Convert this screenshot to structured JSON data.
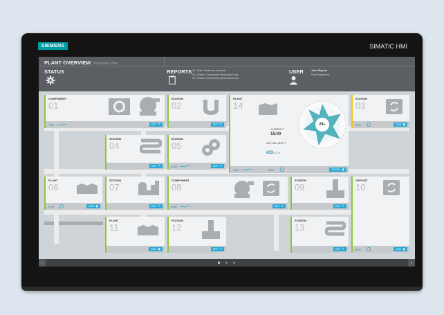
{
  "device": {
    "brand": "SIEMENS",
    "product": "SIMATIC HMI"
  },
  "header": {
    "title": "PLANT OVERVIEW",
    "subtitle": "Production View",
    "status_label": "STATUS",
    "reports_label": "REPORTS",
    "reports_lines": [
      "06 | Plant: Shutdown complete",
      "03 | Station: Unexpected temperature rise",
      "03 | Station: Unexpected performance rise"
    ],
    "user_label": "USER",
    "user_name": "John Regular",
    "user_role": "Plant Supervisor"
  },
  "tiles": [
    {
      "type": "COMPONENT",
      "num": "01",
      "value": "7:05",
      "button": "EDIT",
      "btn_icon": "edit-icon"
    },
    {
      "type": "STATION",
      "num": "02",
      "value": "",
      "button": "EDIT",
      "btn_icon": "edit-icon"
    },
    {
      "type": "PLANT",
      "num": "14",
      "value": "9:00",
      "value2": "6:00",
      "button": "REVIEW",
      "btn_icon": "eye-icon",
      "current_label": "CURRENT",
      "current_value": "15:00",
      "actual_label": "ACTUAL SHIFT",
      "actual_value": "433",
      "actual_total": "/2276",
      "gauge_value": "24",
      "gauge_unit": "%"
    },
    {
      "type": "STATION",
      "num": "03",
      "value": "6:02",
      "button": "VIEW",
      "btn_icon": "eye-icon"
    },
    {
      "type": "STATION",
      "num": "04",
      "value": "",
      "button": "EDIT",
      "btn_icon": "edit-icon"
    },
    {
      "type": "STATION",
      "num": "05",
      "value": "5:00",
      "button": "EDIT",
      "btn_icon": "edit-icon"
    },
    {
      "type": "PLANT",
      "num": "06",
      "value": "9:00",
      "button": "VIEW",
      "btn_icon": "eye-icon"
    },
    {
      "type": "STATION",
      "num": "07",
      "value": "",
      "button": "EDIT",
      "btn_icon": "edit-icon"
    },
    {
      "type": "COMPONENT",
      "num": "08",
      "value": "8:00",
      "button": "EDIT",
      "btn_icon": "edit-icon"
    },
    {
      "type": "STATION",
      "num": "09",
      "value": "",
      "button": "EDIT",
      "btn_icon": "edit-icon"
    },
    {
      "type": "DEPOSIT",
      "num": "10",
      "value": "5:02",
      "button": "VIEW",
      "btn_icon": "eye-icon"
    },
    {
      "type": "PLANT",
      "num": "11",
      "value": "",
      "button": "VIEW",
      "btn_icon": "eye-icon"
    },
    {
      "type": "STATION",
      "num": "12",
      "value": "",
      "button": "EDIT",
      "btn_icon": "edit-icon"
    },
    {
      "type": "STATION",
      "num": "13",
      "value": "",
      "button": "EDIT",
      "btn_icon": "edit-icon"
    }
  ],
  "nav": {
    "left_arrow": "‹",
    "right_arrow": "›",
    "page_count": 3,
    "active_page": 1
  },
  "colors": {
    "accent": "#2aa8d6",
    "green": "#8cc63f",
    "yellow": "#f4c418",
    "teal": "#009ba5"
  }
}
